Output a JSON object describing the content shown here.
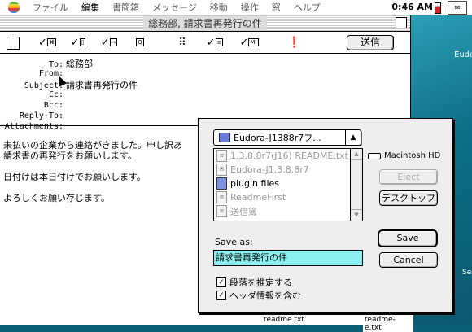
{
  "menubar": {
    "items": [
      "ファイル",
      "編集",
      "書簡箱",
      "メッセージ",
      "移動",
      "操作",
      "窓",
      "ヘルプ"
    ],
    "clock": "0:46 AM"
  },
  "window": {
    "title": "総務部, 請求書再発行の件",
    "send_label": "送信",
    "toolbar_icons": [
      "signature-checkbox-icon",
      "priority-icon",
      "attachment-icon",
      "tab-icon",
      "qp-icon",
      "text-as-attachment-icon",
      "mime-icon",
      "return-receipt-icon"
    ]
  },
  "headers": [
    {
      "label": "To:",
      "value": "総務部"
    },
    {
      "label": "From:",
      "value": ""
    },
    {
      "label": "Subject:",
      "value": "請求書再発行の件"
    },
    {
      "label": "Cc:",
      "value": ""
    },
    {
      "label": "Bcc:",
      "value": ""
    },
    {
      "label": "Reply-To:",
      "value": ""
    },
    {
      "label": "Attachments:",
      "value": ""
    }
  ],
  "body": {
    "line1": "未払いの企業から連絡がきました。申し訳あ",
    "line2": "請求書の再発行をお願いします。",
    "line3": "日付けは本日付けでお願いします。",
    "line4": "よろしくお願い存じます。"
  },
  "dialog": {
    "folder_popup": "Eudora-J1388r7フ...",
    "files": [
      {
        "name": "1.3.8.8r7(J16) README.txt",
        "dim": true
      },
      {
        "name": "Eudora-J1.3.8.8r7",
        "dim": true
      },
      {
        "name": "plugin files",
        "dim": false
      },
      {
        "name": "ReadmeFirst",
        "dim": true
      },
      {
        "name": "送信簿",
        "dim": true
      }
    ],
    "disk_name": "Macintosh HD",
    "eject_label": "Eject",
    "desktop_label": "デスクトップ",
    "save_as_label": "Save as:",
    "save_as_value": "請求書再発行の件",
    "save_label": "Save",
    "cancel_label": "Cancel",
    "checkbox1": "段落を推定する",
    "checkbox2": "ヘッダ情報を含む"
  },
  "desktop": {
    "right_label": "Eudo",
    "file1": "readme.txt",
    "file2": "readme-e.txt",
    "partial_label": "Se"
  }
}
